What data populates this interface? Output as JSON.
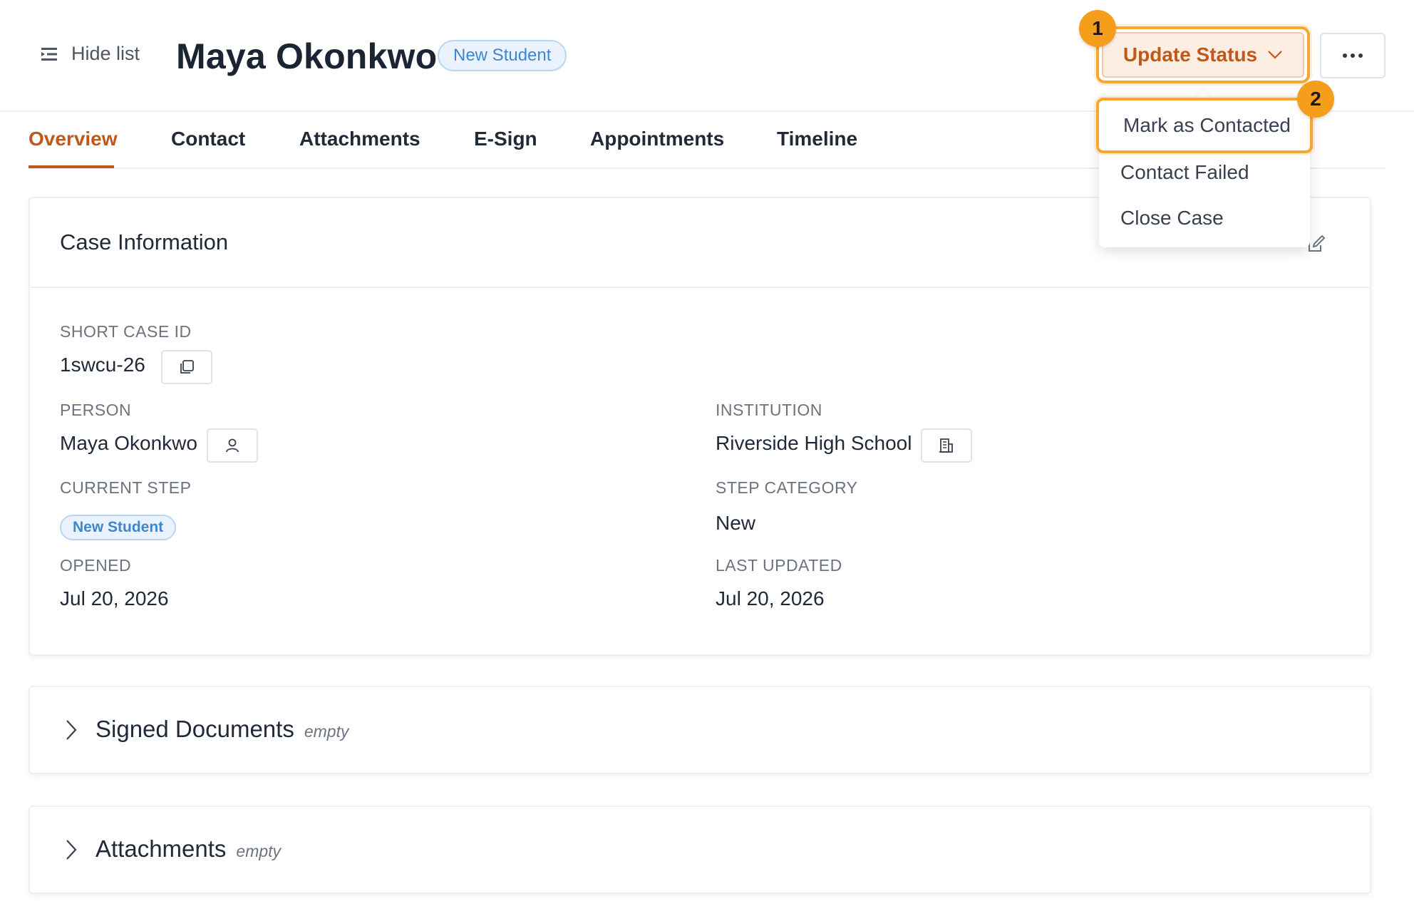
{
  "header": {
    "hide_list_label": "Hide list",
    "title": "Maya Okonkwo",
    "status_badge": "New Student",
    "update_status_label": "Update Status",
    "marker_1": "1",
    "marker_2": "2"
  },
  "tabs": [
    {
      "label": "Overview",
      "active": true
    },
    {
      "label": "Contact"
    },
    {
      "label": "Attachments"
    },
    {
      "label": "E-Sign"
    },
    {
      "label": "Appointments"
    },
    {
      "label": "Timeline"
    }
  ],
  "dropdown": {
    "items": [
      "Mark as Contacted",
      "Contact Failed",
      "Close Case"
    ]
  },
  "case_info": {
    "title": "Case Information",
    "short_case_id_label": "SHORT CASE ID",
    "short_case_id": "1swcu-26",
    "person_label": "PERSON",
    "person": "Maya Okonkwo",
    "institution_label": "INSTITUTION",
    "institution": "Riverside High School",
    "current_step_label": "CURRENT STEP",
    "current_step": "New Student",
    "step_category_label": "STEP CATEGORY",
    "step_category": "New",
    "opened_label": "OPENED",
    "opened": "Jul 20, 2026",
    "last_updated_label": "LAST UPDATED",
    "last_updated": "Jul 20, 2026"
  },
  "sections": [
    {
      "title": "Signed Documents",
      "tag": "empty"
    },
    {
      "title": "Attachments",
      "tag": "empty"
    }
  ],
  "colors": {
    "accent": "#c0581b",
    "highlight": "#f7a630",
    "badge_blue": "#3f86d0"
  }
}
